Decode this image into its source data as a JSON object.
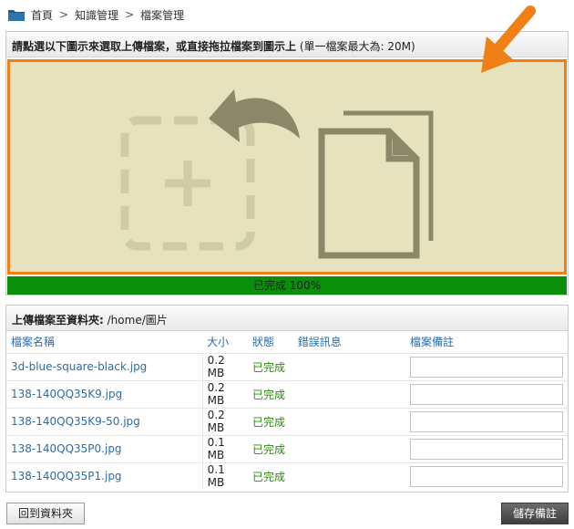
{
  "breadcrumb": {
    "items": [
      "首頁",
      "知識管理",
      "檔案管理"
    ],
    "separator": ">"
  },
  "upload": {
    "instruction_bold": "請點選以下圖示來選取上傳檔案，或直接拖拉檔案到圖示上",
    "instruction_limit": "(單一檔案最大為: 20M)",
    "progress_label": "已完成 100%",
    "progress_value": 100,
    "icons": [
      "add-file-placeholder-icon",
      "undo-arrow-icon",
      "document-stack-icon"
    ]
  },
  "files": {
    "header_label": "上傳檔案至資料夾:",
    "header_path": "/home/圖片",
    "columns": {
      "name": "檔案名稱",
      "size": "大小",
      "status": "狀態",
      "error": "錯誤訊息",
      "note": "檔案備註"
    },
    "rows": [
      {
        "name": "3d-blue-square-black.jpg",
        "size": "0.2 MB",
        "status": "已完成",
        "error": "",
        "note": ""
      },
      {
        "name": "138-140QQ35K9.jpg",
        "size": "0.2 MB",
        "status": "已完成",
        "error": "",
        "note": ""
      },
      {
        "name": "138-140QQ35K9-50.jpg",
        "size": "0.2 MB",
        "status": "已完成",
        "error": "",
        "note": ""
      },
      {
        "name": "138-140QQ35P0.jpg",
        "size": "0.1 MB",
        "status": "已完成",
        "error": "",
        "note": ""
      },
      {
        "name": "138-140QQ35P1.jpg",
        "size": "0.1 MB",
        "status": "已完成",
        "error": "",
        "note": ""
      }
    ]
  },
  "buttons": {
    "back": "回到資料夾",
    "save_notes": "儲存備註"
  },
  "colors": {
    "drop_zone_fill": "#e5e2bd",
    "drop_zone_border": "#f07f15",
    "progress_fill": "#0b8e0b",
    "link": "#2b6ea8",
    "status_done": "#2e8b12"
  }
}
